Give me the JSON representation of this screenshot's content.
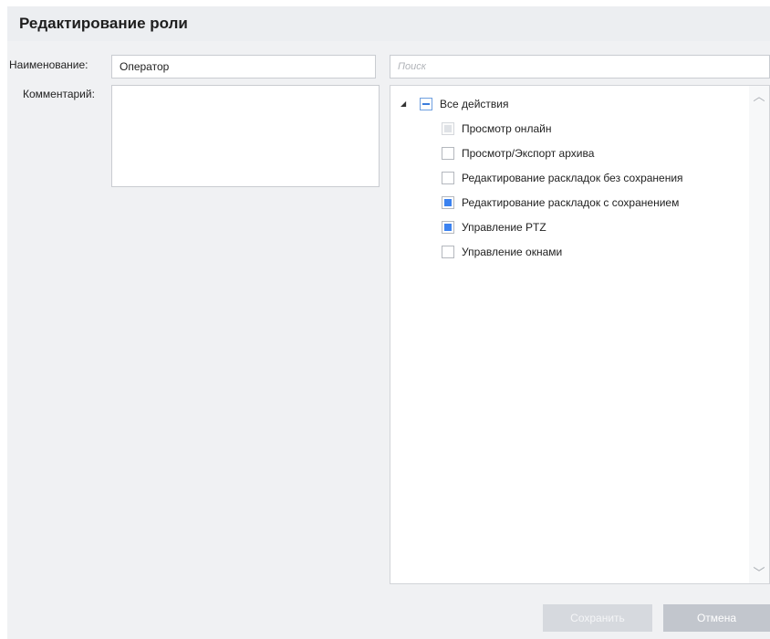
{
  "dialog": {
    "title": "Редактирование роли"
  },
  "form": {
    "name_label": "Наименование:",
    "name_value": "Оператор",
    "comment_label": "Комментарий:",
    "comment_value": ""
  },
  "search": {
    "placeholder": "Поиск"
  },
  "tree": {
    "root": {
      "label": "Все действия",
      "state": "partial",
      "expanded": true
    },
    "items": [
      {
        "label": "Просмотр онлайн",
        "state": "disabled"
      },
      {
        "label": "Просмотр/Экспорт архива",
        "state": "unchecked"
      },
      {
        "label": "Редактирование раскладок без сохранения",
        "state": "unchecked"
      },
      {
        "label": "Редактирование раскладок с сохранением",
        "state": "checked"
      },
      {
        "label": "Управление PTZ",
        "state": "checked"
      },
      {
        "label": "Управление окнами",
        "state": "unchecked"
      }
    ]
  },
  "buttons": {
    "save_label": "Сохранить",
    "cancel_label": "Отмена"
  },
  "icons": {
    "expander": "triangle-down-icon",
    "scroll_up": "chevron-up-icon",
    "scroll_down": "chevron-down-icon"
  },
  "colors": {
    "accent": "#3b82f0",
    "button_disabled": "#d6d9de",
    "button_secondary": "#c2c6cd"
  }
}
